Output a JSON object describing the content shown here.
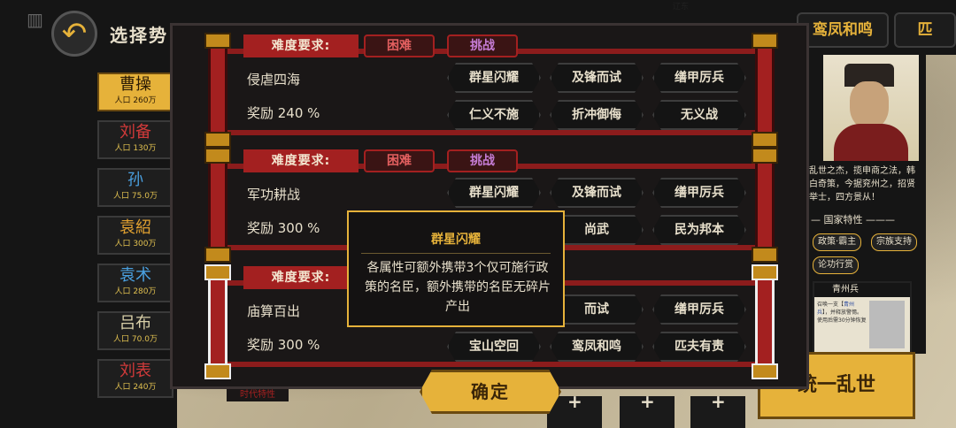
{
  "screen": {
    "title": "选择势",
    "back_icon": "back-arrow-icon",
    "region": "辽东"
  },
  "factions": [
    {
      "name": "曹操",
      "pop": "人口 260万",
      "color": "#2a1a05",
      "selected": true
    },
    {
      "name": "刘备",
      "pop": "人口 130万",
      "color": "#d03a3a"
    },
    {
      "name": "孙",
      "pop": "人口 75.0万",
      "color": "#4aa0e0"
    },
    {
      "name": "袁紹",
      "pop": "人口 300万",
      "color": "#e0a030"
    },
    {
      "name": "袁术",
      "pop": "人口 280万",
      "color": "#4aa0e0"
    },
    {
      "name": "吕布",
      "pop": "人口 70.0万",
      "color": "#d8cfa8"
    },
    {
      "name": "刘表",
      "pop": "人口 240万",
      "color": "#d03a3a"
    }
  ],
  "top_tabs": [
    "鸾凤和鸣",
    "匹"
  ],
  "bio": "乱世之杰，揽申商之法，韩白奇策，今据兖州之，招贤举士，四方景从！",
  "traits": {
    "title": "国家特性",
    "chips": [
      "政策·霸主",
      "宗族支持",
      "论功行赏"
    ]
  },
  "unit": {
    "name": "青州兵",
    "desc_a": "召唤一支【",
    "desc_hl": "青州兵",
    "desc_b": "】，并释放",
    "desc_c": "警惕。使用后需30分钟恢复"
  },
  "big_button": "统一乱世",
  "modal": {
    "req_label": "难度要求:",
    "hard": "困难",
    "challenge": "挑战",
    "rows": [
      {
        "name": "侵虐四海",
        "reward": "奖励  240 %",
        "tags": [
          "群星闪耀",
          "及锋而试",
          "缮甲厉兵",
          "仁义不施",
          "折冲御侮",
          "无义战"
        ]
      },
      {
        "name": "军功耕战",
        "reward": "奖励  300 %",
        "tags": [
          "群星闪耀",
          "及锋而试",
          "缮甲厉兵",
          "",
          "尚武",
          "民为邦本"
        ]
      },
      {
        "name": "庙算百出",
        "reward": "奖励  300 %",
        "tags": [
          "",
          "而试",
          "缮甲厉兵",
          "宝山空回",
          "鸾凤和鸣",
          "匹夫有责"
        ]
      }
    ],
    "tooltip": {
      "title": "群星闪耀",
      "body": "各属性可额外携带3个仅可施行政策的名臣，额外携带的名臣无碎片产出"
    },
    "confirm": "确定",
    "era": "时代特性"
  },
  "slot_plus": "+"
}
